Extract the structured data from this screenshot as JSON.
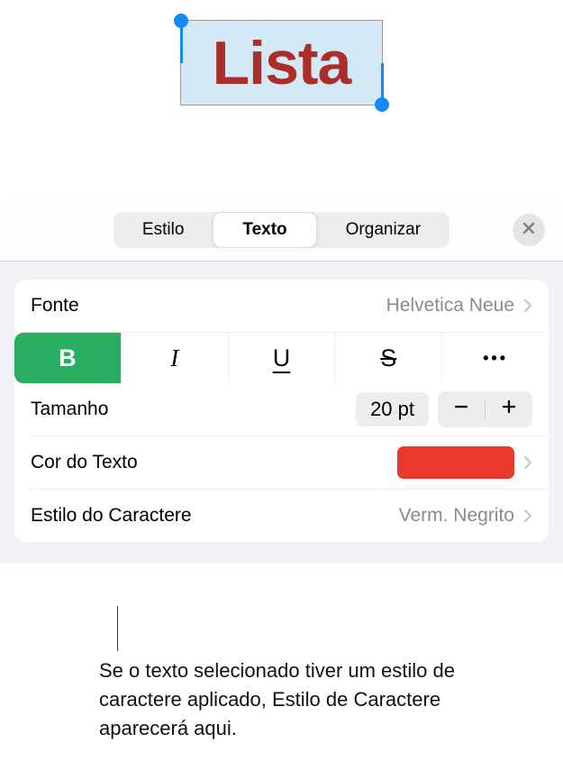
{
  "canvas": {
    "selected_text": "Lista"
  },
  "tabs": {
    "items": [
      "Estilo",
      "Texto",
      "Organizar"
    ],
    "active_index": 1
  },
  "font_row": {
    "label": "Fonte",
    "value": "Helvetica Neue"
  },
  "format_buttons": {
    "bold": "B",
    "italic": "I",
    "underline": "U",
    "strike": "S",
    "more": "•••",
    "bold_active": true
  },
  "size_row": {
    "label": "Tamanho",
    "value": "20 pt"
  },
  "color_row": {
    "label": "Cor do Texto",
    "swatch_color": "#e8392c"
  },
  "charstyle_row": {
    "label": "Estilo do Caractere",
    "value": "Verm. Negrito"
  },
  "callout": {
    "text": "Se o texto selecionado tiver um estilo de caractere aplicado, Estilo de Caractere aparecerá aqui."
  }
}
